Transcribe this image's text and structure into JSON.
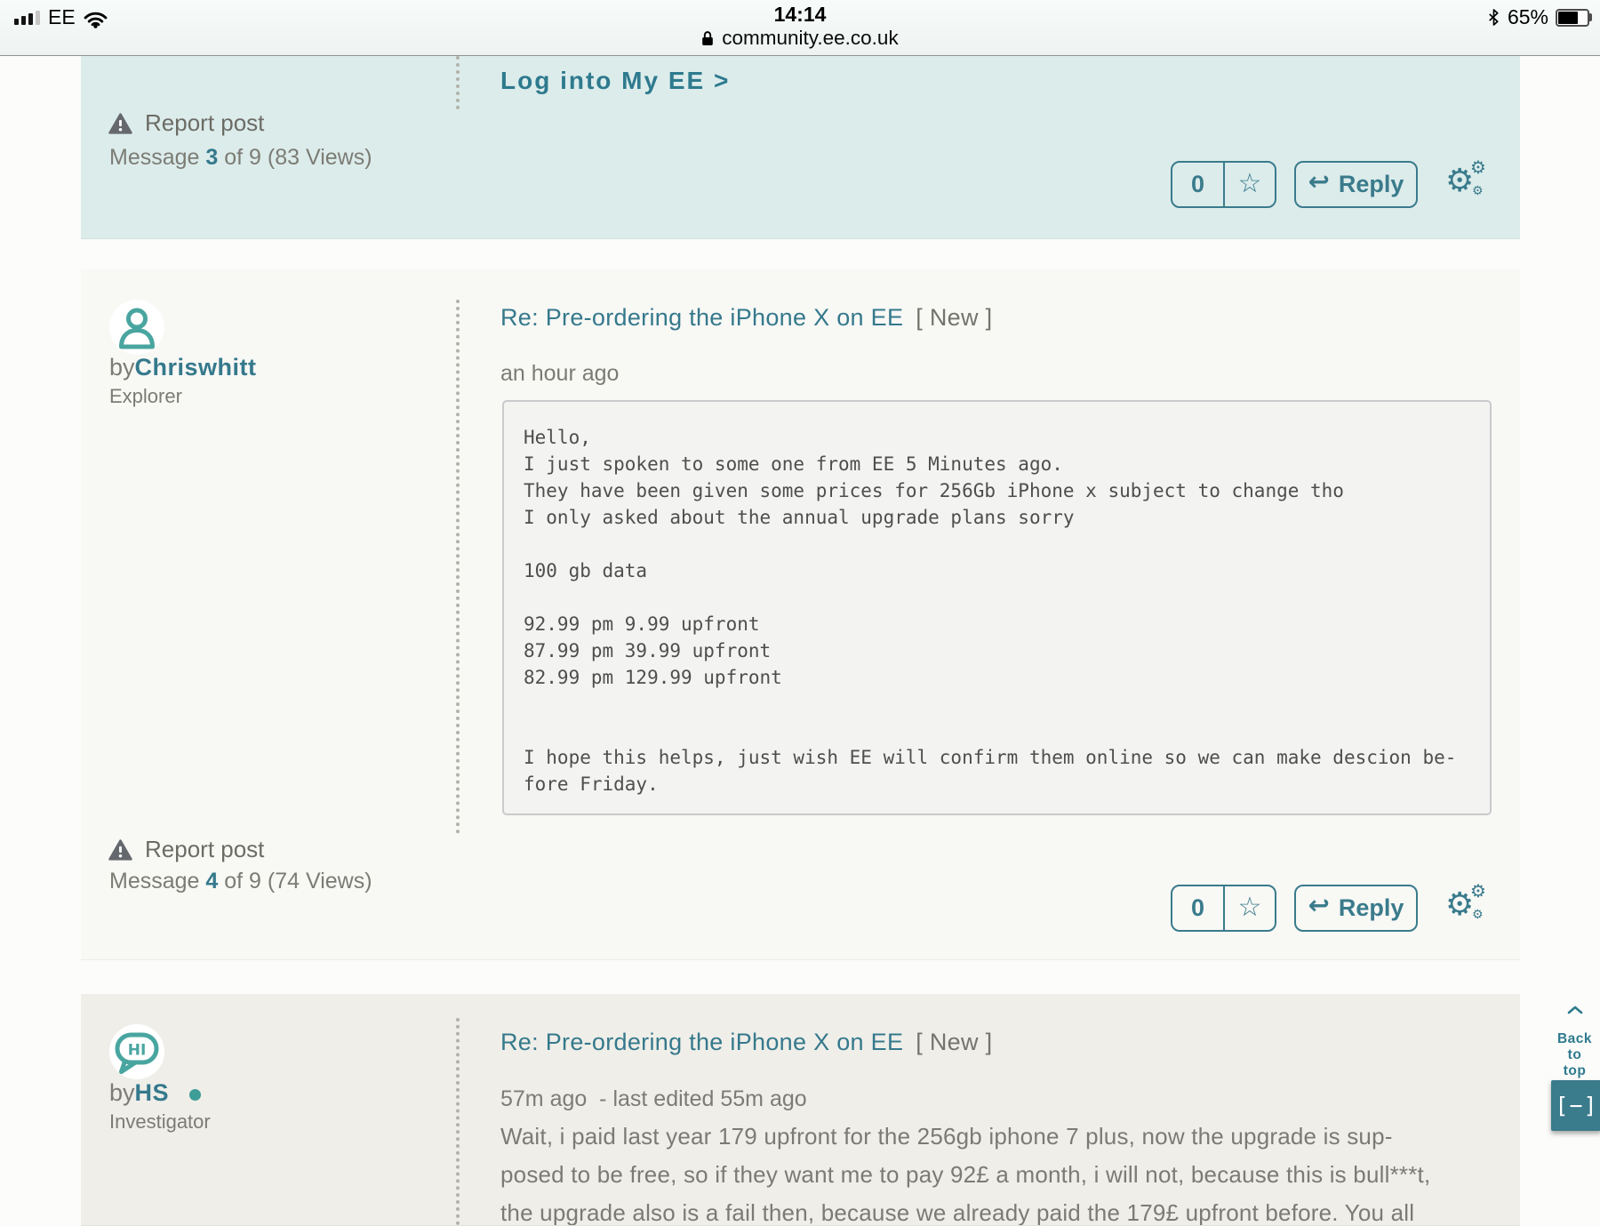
{
  "status_bar": {
    "carrier": "EE",
    "time": "14:14",
    "battery": "65%",
    "url": "community.ee.co.uk"
  },
  "icons": {
    "star": "☆",
    "gear": "⚙",
    "reply_arrow": "↩"
  },
  "banner": {
    "login_link": "Log into My EE >",
    "report_label": "Report post",
    "meta_prefix": "Message ",
    "meta_number": "3",
    "meta_suffix": " of 9 (83 Views)",
    "kudos_count": "0",
    "reply_label": "Reply"
  },
  "post1": {
    "by": "by ",
    "author": "Chriswhitt",
    "rank": "Explorer",
    "title": "Re: Pre-ordering the iPhone X on EE",
    "badge": "[ New ]",
    "timestamp": "an hour ago",
    "body": "Hello,\nI just spoken to some one from EE 5 Minutes ago.\nThey have been given some prices for 256Gb iPhone x subject to change tho\nI only asked about the annual upgrade plans sorry\n\n100 gb data\n\n92.99 pm 9.99 upfront\n87.99 pm 39.99 upfront\n82.99 pm 129.99 upfront\n\n\nI hope this helps, just wish EE will confirm them online so we can make descion be-\nfore Friday.",
    "report_label": "Report post",
    "meta_prefix": "Message ",
    "meta_number": "4",
    "meta_suffix": " of 9 (74 Views)",
    "kudos_count": "0",
    "reply_label": "Reply"
  },
  "post2": {
    "by": "by ",
    "author": "HS",
    "rank": "Investigator",
    "title": "Re: Pre-ordering the iPhone X on EE",
    "badge": "[ New ]",
    "timestamp": "57m ago  - last edited 55m ago",
    "body": "Wait, i paid last year 179 upfront for the 256gb iphone 7 plus, now the upgrade is sup-\nposed to be free, so if they want me to pay 92£ a month, i will not, because this is bull***t,\nthe upgrade also is a fail then, because we already paid the 179£ upfront before. You all"
  },
  "side": {
    "back_to_top": "Back\nto\ntop",
    "collapse": "[−]"
  },
  "colors": {
    "accent_teal": "#3a7b8c",
    "avatar_teal": "#49a5a0",
    "banner_bg": "#dceceb",
    "post_bg": "#f8f8f5",
    "post3_bg": "#efeee9"
  }
}
